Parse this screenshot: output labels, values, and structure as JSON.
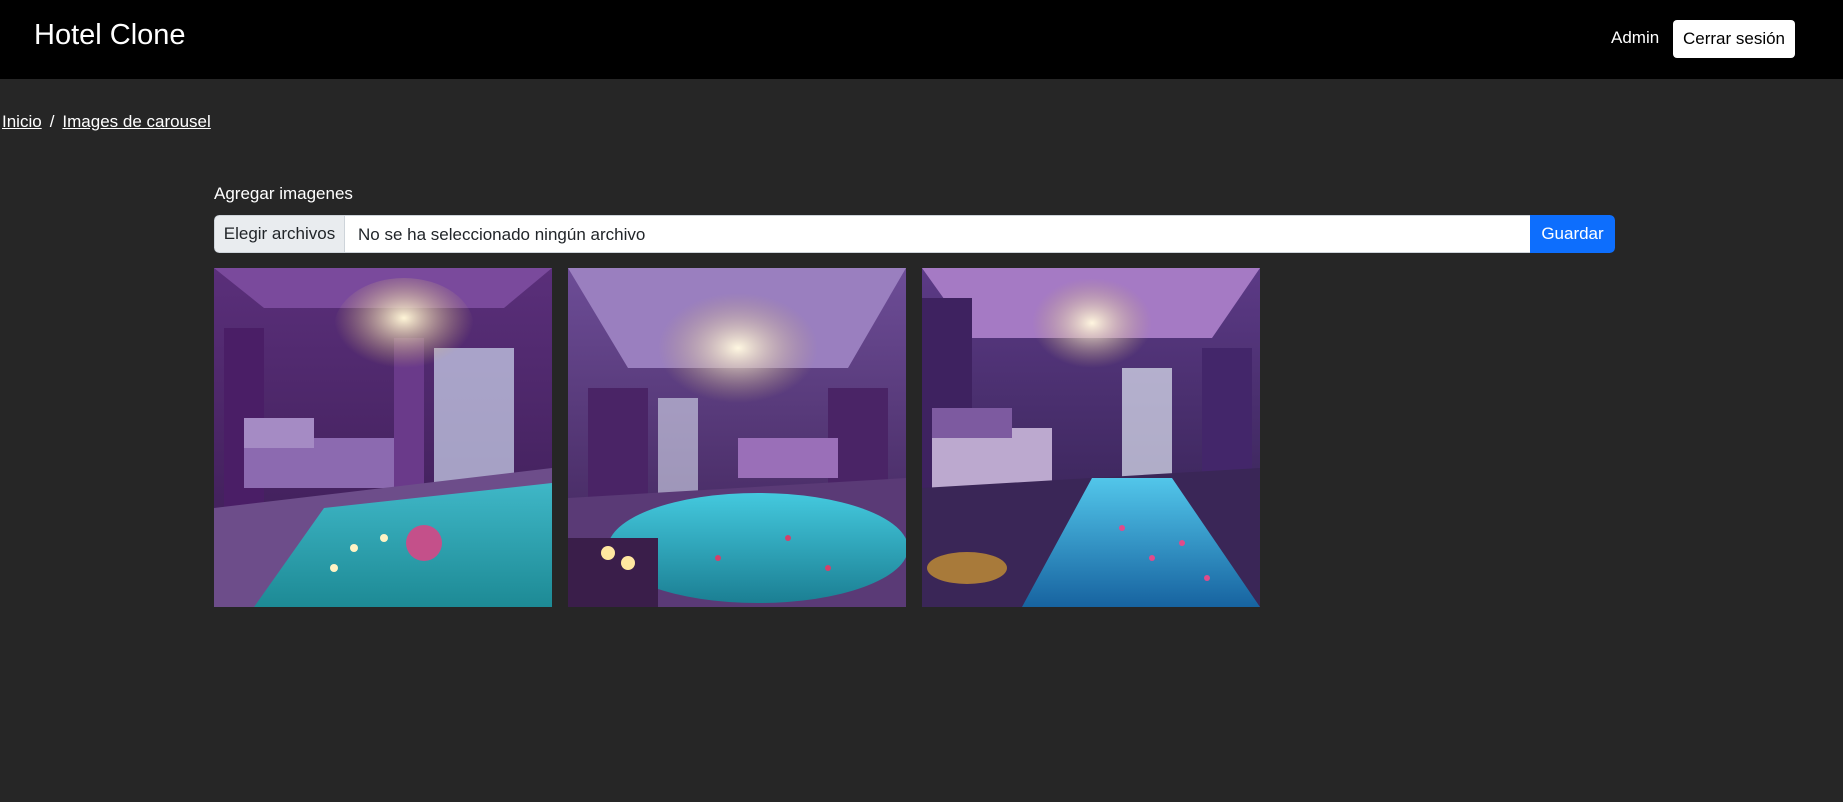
{
  "header": {
    "brand": "Hotel Clone",
    "user": "Admin",
    "logout_label": "Cerrar sesión"
  },
  "breadcrumb": {
    "items": [
      "Inicio",
      "Images de carousel"
    ],
    "separator": "/"
  },
  "upload": {
    "label": "Agregar imagenes",
    "choose_label": "Elegir archivos",
    "status": "No se ha seleccionado ningún archivo",
    "save_label": "Guardar"
  },
  "gallery": {
    "images": [
      {
        "alt": "Luxury purple bedroom with chandelier and indoor pool"
      },
      {
        "alt": "Luxury purple bedroom with ornate ceiling and round pool"
      },
      {
        "alt": "Luxury purple bedroom with long reflective pool"
      }
    ]
  },
  "colors": {
    "navbar": "#000000",
    "page_bg": "#262626",
    "primary": "#0d6efd"
  }
}
